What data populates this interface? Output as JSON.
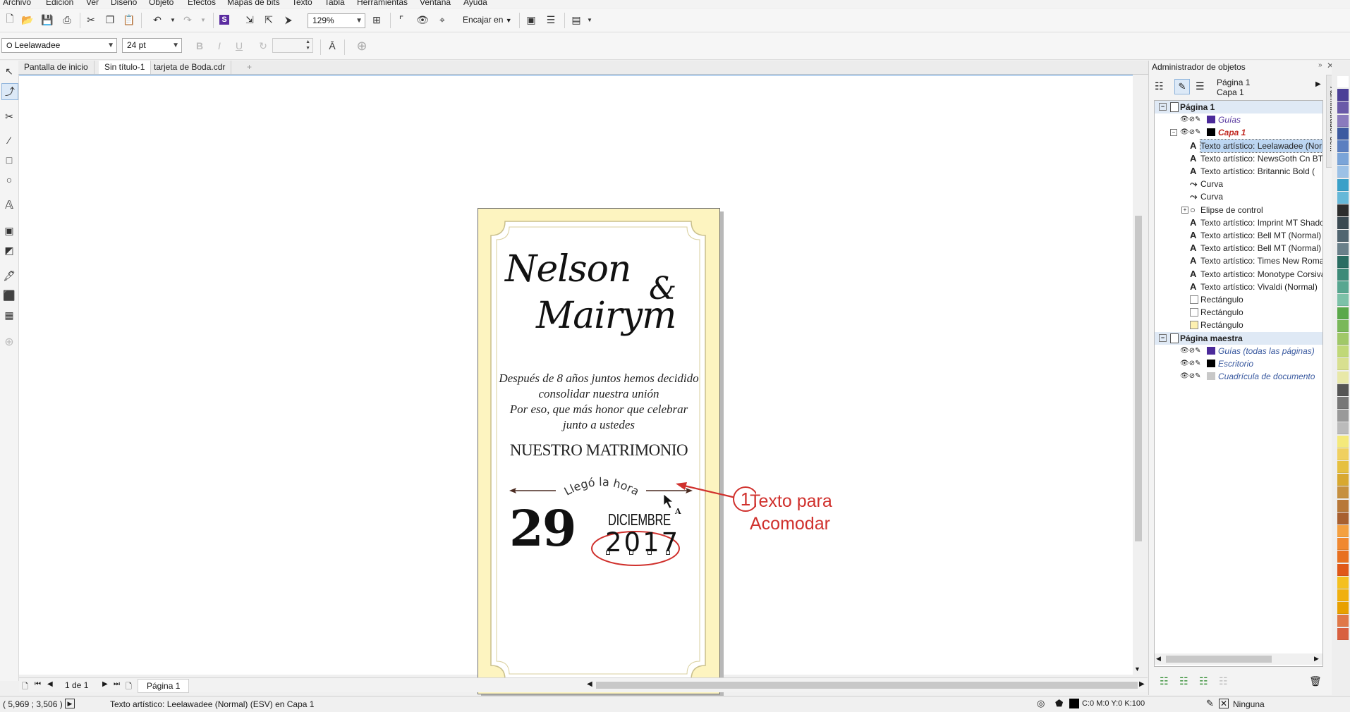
{
  "menu": [
    "Archivo",
    "Edición",
    "Ver",
    "Diseño",
    "Objeto",
    "Efectos",
    "Mapas de bits",
    "Texto",
    "Tabla",
    "Herramientas",
    "Ventana",
    "Ayuda"
  ],
  "toolbar": {
    "zoom": "129%",
    "fit_label": "Encajar en"
  },
  "propbar": {
    "font_name": "Leelawadee",
    "font_size": "24 pt"
  },
  "tabs": [
    "Pantalla de inicio",
    "Sin título-1",
    "tarjeta de Boda.cdr"
  ],
  "tab_add": "+",
  "card": {
    "name1": "Nelson",
    "amp": "&",
    "name2": "Mairym",
    "line1": "Después de 8 años juntos hemos decidido",
    "line2": "consolidar nuestra unión",
    "line3": "Por eso, que más honor que celebrar",
    "line4": "junto a ustedes",
    "headline": "NUESTRO MATRIMONIO",
    "arc_text": "Llegó la hora",
    "day": "29",
    "month": "DICIEMBRE",
    "year": "2017"
  },
  "annotation": {
    "number": "1",
    "line1": "Texto para",
    "line2": "Acomodar",
    "color": "#d0312d"
  },
  "pagebar": {
    "page_counter": "1 de 1",
    "page_tab": "Página 1"
  },
  "status": {
    "coords": "( 5,969 ; 3,506 )",
    "object_info": "Texto artístico: Leelawadee (Normal) (ESV) en Capa 1",
    "fill": "C:0 M:0 Y:0 K:100",
    "outline": "Ninguna"
  },
  "docker": {
    "title": "Administrador de objetos",
    "side_tab": "Administrador de...",
    "current_page": "Página 1",
    "current_layer": "Capa 1",
    "tree": [
      {
        "label": "Página 1",
        "level": 0,
        "kind": "page"
      },
      {
        "label": "Guías",
        "level": 1,
        "kind": "guides"
      },
      {
        "label": "Capa 1",
        "level": 1,
        "kind": "layer"
      },
      {
        "label": "Texto artístico: Leelawadee (Normal)",
        "level": 2,
        "kind": "text",
        "selected": true
      },
      {
        "label": "Texto artístico: NewsGoth Cn BT",
        "level": 2,
        "kind": "text"
      },
      {
        "label": "Texto artístico: Britannic Bold (",
        "level": 2,
        "kind": "text"
      },
      {
        "label": "Curva",
        "level": 2,
        "kind": "curve"
      },
      {
        "label": "Curva",
        "level": 2,
        "kind": "curve"
      },
      {
        "label": "Elipse de control",
        "level": 2,
        "kind": "ellipse"
      },
      {
        "label": "Texto artístico: Imprint MT Shadow",
        "level": 2,
        "kind": "text"
      },
      {
        "label": "Texto artístico: Bell MT (Normal)",
        "level": 2,
        "kind": "text"
      },
      {
        "label": "Texto artístico: Bell MT (Normal)",
        "level": 2,
        "kind": "text"
      },
      {
        "label": "Texto artístico: Times New Roman",
        "level": 2,
        "kind": "text"
      },
      {
        "label": "Texto artístico: Monotype Corsiva",
        "level": 2,
        "kind": "text"
      },
      {
        "label": "Texto artístico: Vivaldi (Normal)",
        "level": 2,
        "kind": "text"
      },
      {
        "label": "Rectángulo",
        "level": 2,
        "kind": "rect"
      },
      {
        "label": "Rectángulo",
        "level": 2,
        "kind": "rect"
      },
      {
        "label": "Rectángulo",
        "level": 2,
        "kind": "rect-yellow"
      },
      {
        "label": "Página maestra",
        "level": 0,
        "kind": "page"
      },
      {
        "label": "Guías (todas las páginas)",
        "level": 1,
        "kind": "guides"
      },
      {
        "label": "Escritorio",
        "level": 1,
        "kind": "desk"
      },
      {
        "label": "Cuadrícula de documento",
        "level": 1,
        "kind": "grid"
      }
    ]
  },
  "palette_colors": [
    "#ffffff",
    "#4b3f97",
    "#6a5aa8",
    "#8a7bbd",
    "#3d5aa0",
    "#5b7fc0",
    "#7aa4d8",
    "#9cc1e6",
    "#3aa0c8",
    "#66b8d8",
    "#2d2d2d",
    "#3b4a52",
    "#516570",
    "#6a808a",
    "#2a6d62",
    "#3d8a78",
    "#58a690",
    "#7cc1a8",
    "#5aa84a",
    "#7ab85a",
    "#a0c868",
    "#c0d878",
    "#d8e090",
    "#e8e8a8",
    "#555555",
    "#777777",
    "#999999",
    "#bbbbbb",
    "#f4e97a",
    "#f0d060",
    "#e6c040",
    "#d8a830",
    "#c69040",
    "#b87838",
    "#a86030",
    "#f4a040",
    "#f08830",
    "#e87020",
    "#e05818",
    "#f4c020",
    "#f0b010",
    "#e8a000",
    "#e07848",
    "#d86040"
  ]
}
